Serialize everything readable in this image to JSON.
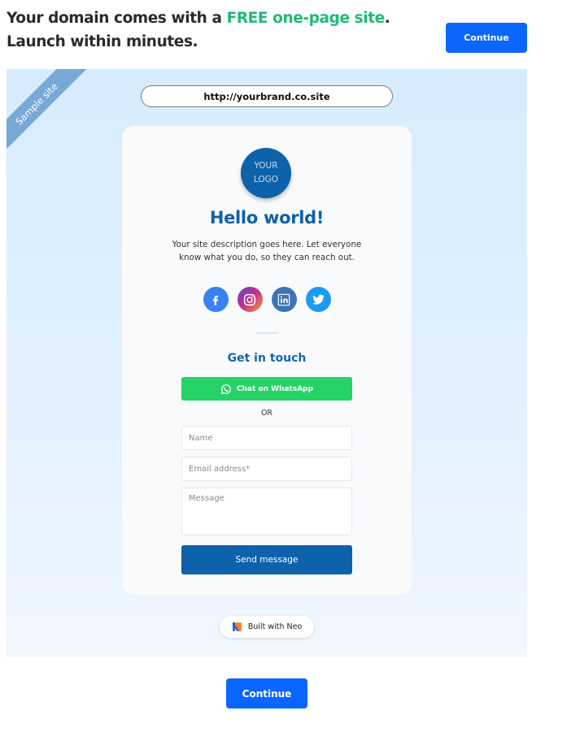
{
  "header": {
    "headline_part1": "Your domain comes with a ",
    "headline_accent": "FREE one-page site",
    "headline_part2": ".",
    "headline_line2": "Launch within minutes.",
    "accent_color": "#1fb978",
    "continue_label": "Continue"
  },
  "preview": {
    "ribbon_label": "Sample site",
    "url": "http://yourbrand.co.site",
    "card": {
      "logo_line1": "YOUR",
      "logo_line2": "LOGO",
      "title": "Hello world!",
      "description": "Your site description goes here. Let everyone know what you do, so they can reach out.",
      "socials": [
        {
          "name": "Facebook",
          "icon": "facebook-icon"
        },
        {
          "name": "Instagram",
          "icon": "instagram-icon"
        },
        {
          "name": "LinkedIn",
          "icon": "linkedin-icon"
        },
        {
          "name": "Twitter",
          "icon": "twitter-icon"
        }
      ],
      "contact_heading": "Get in touch",
      "whatsapp_label": "Chat on WhatsApp",
      "or_label": "OR",
      "form": {
        "name_placeholder": "Name",
        "name_value": "",
        "email_placeholder": "Email address*",
        "email_value": "",
        "message_placeholder": "Message",
        "message_value": "",
        "send_label": "Send message"
      }
    },
    "built_with_label": "Built with Neo"
  },
  "footer": {
    "continue_label": "Continue"
  },
  "colors": {
    "primary_button": "#0a66ff",
    "brand_blue": "#0e62aa",
    "whatsapp_green": "#25d366"
  }
}
